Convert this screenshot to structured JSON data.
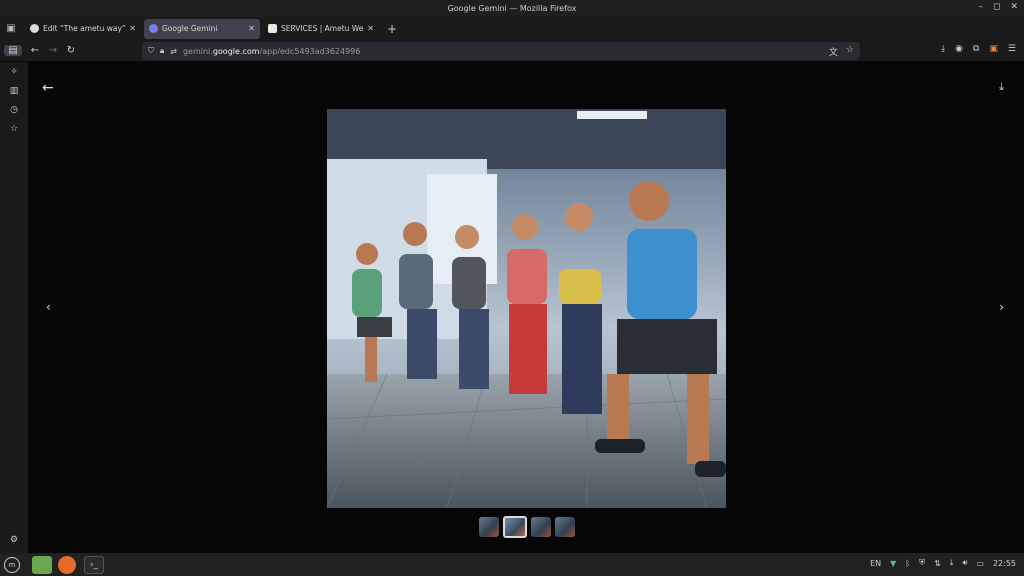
{
  "window": {
    "title": "Google Gemini — Mozilla Firefox"
  },
  "tabs": [
    {
      "title": "Edit “The ametu way” with"
    },
    {
      "title": "Google Gemini"
    },
    {
      "title": "SERVICES | Ametu Wellness"
    }
  ],
  "url": {
    "prefix": "gemini.",
    "domain": "google.com",
    "path": "/app/edc5493ad3624996"
  },
  "viewer": {
    "thumbnail_count": 4,
    "selected_thumbnail": 2
  },
  "tray": {
    "lang": "EN",
    "time": "22:55"
  },
  "colors": {
    "accent": "#42414d",
    "background": "#060606"
  }
}
